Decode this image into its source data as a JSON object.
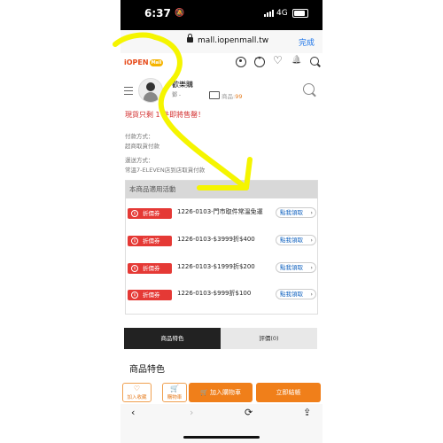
{
  "status": {
    "time": "6:37",
    "network": "4G"
  },
  "browser": {
    "url": "mall.iopenmall.tw",
    "done_label": "完成"
  },
  "site": {
    "logo": "iOPEN",
    "logo_badge": "Mall"
  },
  "store": {
    "name": "歡樂購",
    "sub": "鄧 -",
    "products_label": "商品:",
    "products_count": "99"
  },
  "stock_warning": "現貨只剩 1 件即將售罄！",
  "payment": {
    "label": "付款方式：",
    "value": "超商取貨付款"
  },
  "shipping": {
    "label": "運送方式：",
    "value": "常溫7-ELEVEN店到店取貨付款"
  },
  "promo": {
    "title": "本商品適用活動",
    "coupons": [
      {
        "tag": "折價券",
        "text": "1226-0103-門市取件常溫免運",
        "button": "點我領取"
      },
      {
        "tag": "折價券",
        "text": "1226-0103-$3999折$400",
        "button": "點我領取"
      },
      {
        "tag": "折價券",
        "text": "1226-0103-$1999折$200",
        "button": "點我領取"
      },
      {
        "tag": "折價券",
        "text": "1226-0103-$999折$100",
        "button": "點我領取"
      }
    ]
  },
  "tabs": [
    {
      "label": "商品特色"
    },
    {
      "label": "評價(0)"
    }
  ],
  "section_title": "商品特色",
  "actions": {
    "favorite": "加入收藏",
    "cart_small": "購物車",
    "add_cart": "加入購物車",
    "checkout": "立即結帳"
  },
  "annotation": {
    "color": "#f5f500"
  }
}
